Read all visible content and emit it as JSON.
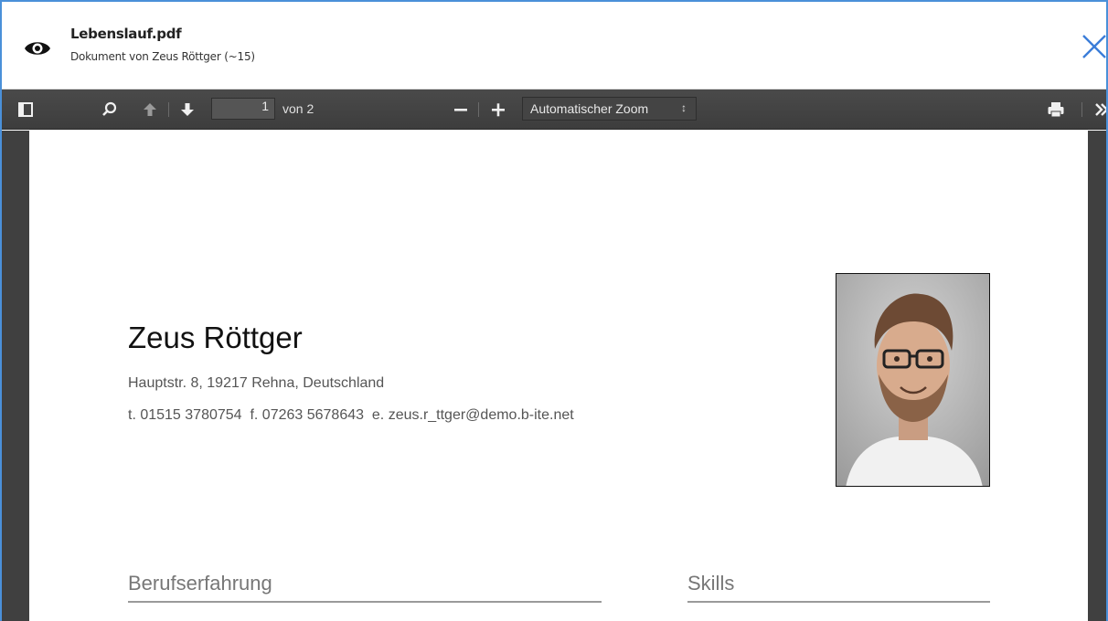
{
  "header": {
    "title": "Lebenslauf.pdf",
    "subtitle": "Dokument von Zeus Röttger (~15)"
  },
  "toolbar": {
    "page_number": "1",
    "page_of": "von 2",
    "zoom_value": "Automatischer Zoom",
    "icons": [
      "sidebar-toggle-icon",
      "search-icon",
      "previous-page-icon",
      "next-page-icon",
      "zoom-out-icon",
      "zoom-in-icon",
      "print-icon",
      "more-tools-icon"
    ]
  },
  "document": {
    "name": "Zeus Röttger",
    "address": "Hauptstr. 8, 19217 Rehna, Deutschland",
    "contact": "t. 01515 3780754  f. 07263 5678643  e. zeus.r_ttger@demo.b-ite.net",
    "sections": [
      "Berufserfahrung",
      "Skills"
    ]
  },
  "colors": {
    "frame_border": "#4a90d9",
    "close_icon": "#3b7dd8",
    "toolbar_bg": "#474747",
    "viewer_bg": "#404040"
  }
}
